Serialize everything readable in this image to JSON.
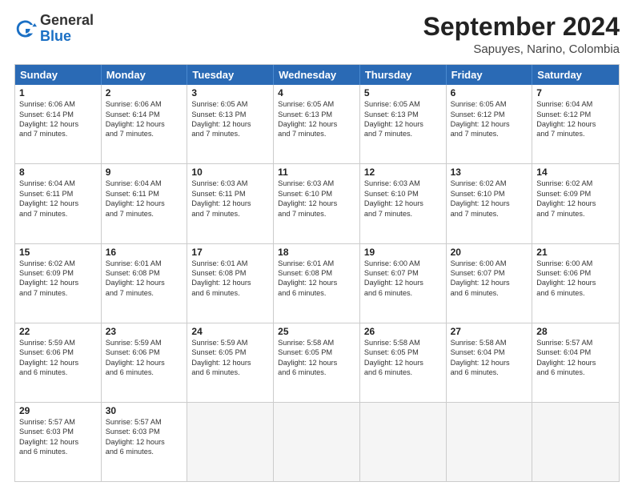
{
  "logo": {
    "general": "General",
    "blue": "Blue"
  },
  "header": {
    "month_title": "September 2024",
    "subtitle": "Sapuyes, Narino, Colombia"
  },
  "days_of_week": [
    "Sunday",
    "Monday",
    "Tuesday",
    "Wednesday",
    "Thursday",
    "Friday",
    "Saturday"
  ],
  "weeks": [
    [
      {
        "day": "1",
        "info": "Sunrise: 6:06 AM\nSunset: 6:14 PM\nDaylight: 12 hours\nand 7 minutes."
      },
      {
        "day": "2",
        "info": "Sunrise: 6:06 AM\nSunset: 6:14 PM\nDaylight: 12 hours\nand 7 minutes."
      },
      {
        "day": "3",
        "info": "Sunrise: 6:05 AM\nSunset: 6:13 PM\nDaylight: 12 hours\nand 7 minutes."
      },
      {
        "day": "4",
        "info": "Sunrise: 6:05 AM\nSunset: 6:13 PM\nDaylight: 12 hours\nand 7 minutes."
      },
      {
        "day": "5",
        "info": "Sunrise: 6:05 AM\nSunset: 6:13 PM\nDaylight: 12 hours\nand 7 minutes."
      },
      {
        "day": "6",
        "info": "Sunrise: 6:05 AM\nSunset: 6:12 PM\nDaylight: 12 hours\nand 7 minutes."
      },
      {
        "day": "7",
        "info": "Sunrise: 6:04 AM\nSunset: 6:12 PM\nDaylight: 12 hours\nand 7 minutes."
      }
    ],
    [
      {
        "day": "8",
        "info": "Sunrise: 6:04 AM\nSunset: 6:11 PM\nDaylight: 12 hours\nand 7 minutes."
      },
      {
        "day": "9",
        "info": "Sunrise: 6:04 AM\nSunset: 6:11 PM\nDaylight: 12 hours\nand 7 minutes."
      },
      {
        "day": "10",
        "info": "Sunrise: 6:03 AM\nSunset: 6:11 PM\nDaylight: 12 hours\nand 7 minutes."
      },
      {
        "day": "11",
        "info": "Sunrise: 6:03 AM\nSunset: 6:10 PM\nDaylight: 12 hours\nand 7 minutes."
      },
      {
        "day": "12",
        "info": "Sunrise: 6:03 AM\nSunset: 6:10 PM\nDaylight: 12 hours\nand 7 minutes."
      },
      {
        "day": "13",
        "info": "Sunrise: 6:02 AM\nSunset: 6:10 PM\nDaylight: 12 hours\nand 7 minutes."
      },
      {
        "day": "14",
        "info": "Sunrise: 6:02 AM\nSunset: 6:09 PM\nDaylight: 12 hours\nand 7 minutes."
      }
    ],
    [
      {
        "day": "15",
        "info": "Sunrise: 6:02 AM\nSunset: 6:09 PM\nDaylight: 12 hours\nand 7 minutes."
      },
      {
        "day": "16",
        "info": "Sunrise: 6:01 AM\nSunset: 6:08 PM\nDaylight: 12 hours\nand 7 minutes."
      },
      {
        "day": "17",
        "info": "Sunrise: 6:01 AM\nSunset: 6:08 PM\nDaylight: 12 hours\nand 6 minutes."
      },
      {
        "day": "18",
        "info": "Sunrise: 6:01 AM\nSunset: 6:08 PM\nDaylight: 12 hours\nand 6 minutes."
      },
      {
        "day": "19",
        "info": "Sunrise: 6:00 AM\nSunset: 6:07 PM\nDaylight: 12 hours\nand 6 minutes."
      },
      {
        "day": "20",
        "info": "Sunrise: 6:00 AM\nSunset: 6:07 PM\nDaylight: 12 hours\nand 6 minutes."
      },
      {
        "day": "21",
        "info": "Sunrise: 6:00 AM\nSunset: 6:06 PM\nDaylight: 12 hours\nand 6 minutes."
      }
    ],
    [
      {
        "day": "22",
        "info": "Sunrise: 5:59 AM\nSunset: 6:06 PM\nDaylight: 12 hours\nand 6 minutes."
      },
      {
        "day": "23",
        "info": "Sunrise: 5:59 AM\nSunset: 6:06 PM\nDaylight: 12 hours\nand 6 minutes."
      },
      {
        "day": "24",
        "info": "Sunrise: 5:59 AM\nSunset: 6:05 PM\nDaylight: 12 hours\nand 6 minutes."
      },
      {
        "day": "25",
        "info": "Sunrise: 5:58 AM\nSunset: 6:05 PM\nDaylight: 12 hours\nand 6 minutes."
      },
      {
        "day": "26",
        "info": "Sunrise: 5:58 AM\nSunset: 6:05 PM\nDaylight: 12 hours\nand 6 minutes."
      },
      {
        "day": "27",
        "info": "Sunrise: 5:58 AM\nSunset: 6:04 PM\nDaylight: 12 hours\nand 6 minutes."
      },
      {
        "day": "28",
        "info": "Sunrise: 5:57 AM\nSunset: 6:04 PM\nDaylight: 12 hours\nand 6 minutes."
      }
    ],
    [
      {
        "day": "29",
        "info": "Sunrise: 5:57 AM\nSunset: 6:03 PM\nDaylight: 12 hours\nand 6 minutes."
      },
      {
        "day": "30",
        "info": "Sunrise: 5:57 AM\nSunset: 6:03 PM\nDaylight: 12 hours\nand 6 minutes."
      },
      {
        "day": "",
        "info": ""
      },
      {
        "day": "",
        "info": ""
      },
      {
        "day": "",
        "info": ""
      },
      {
        "day": "",
        "info": ""
      },
      {
        "day": "",
        "info": ""
      }
    ]
  ]
}
